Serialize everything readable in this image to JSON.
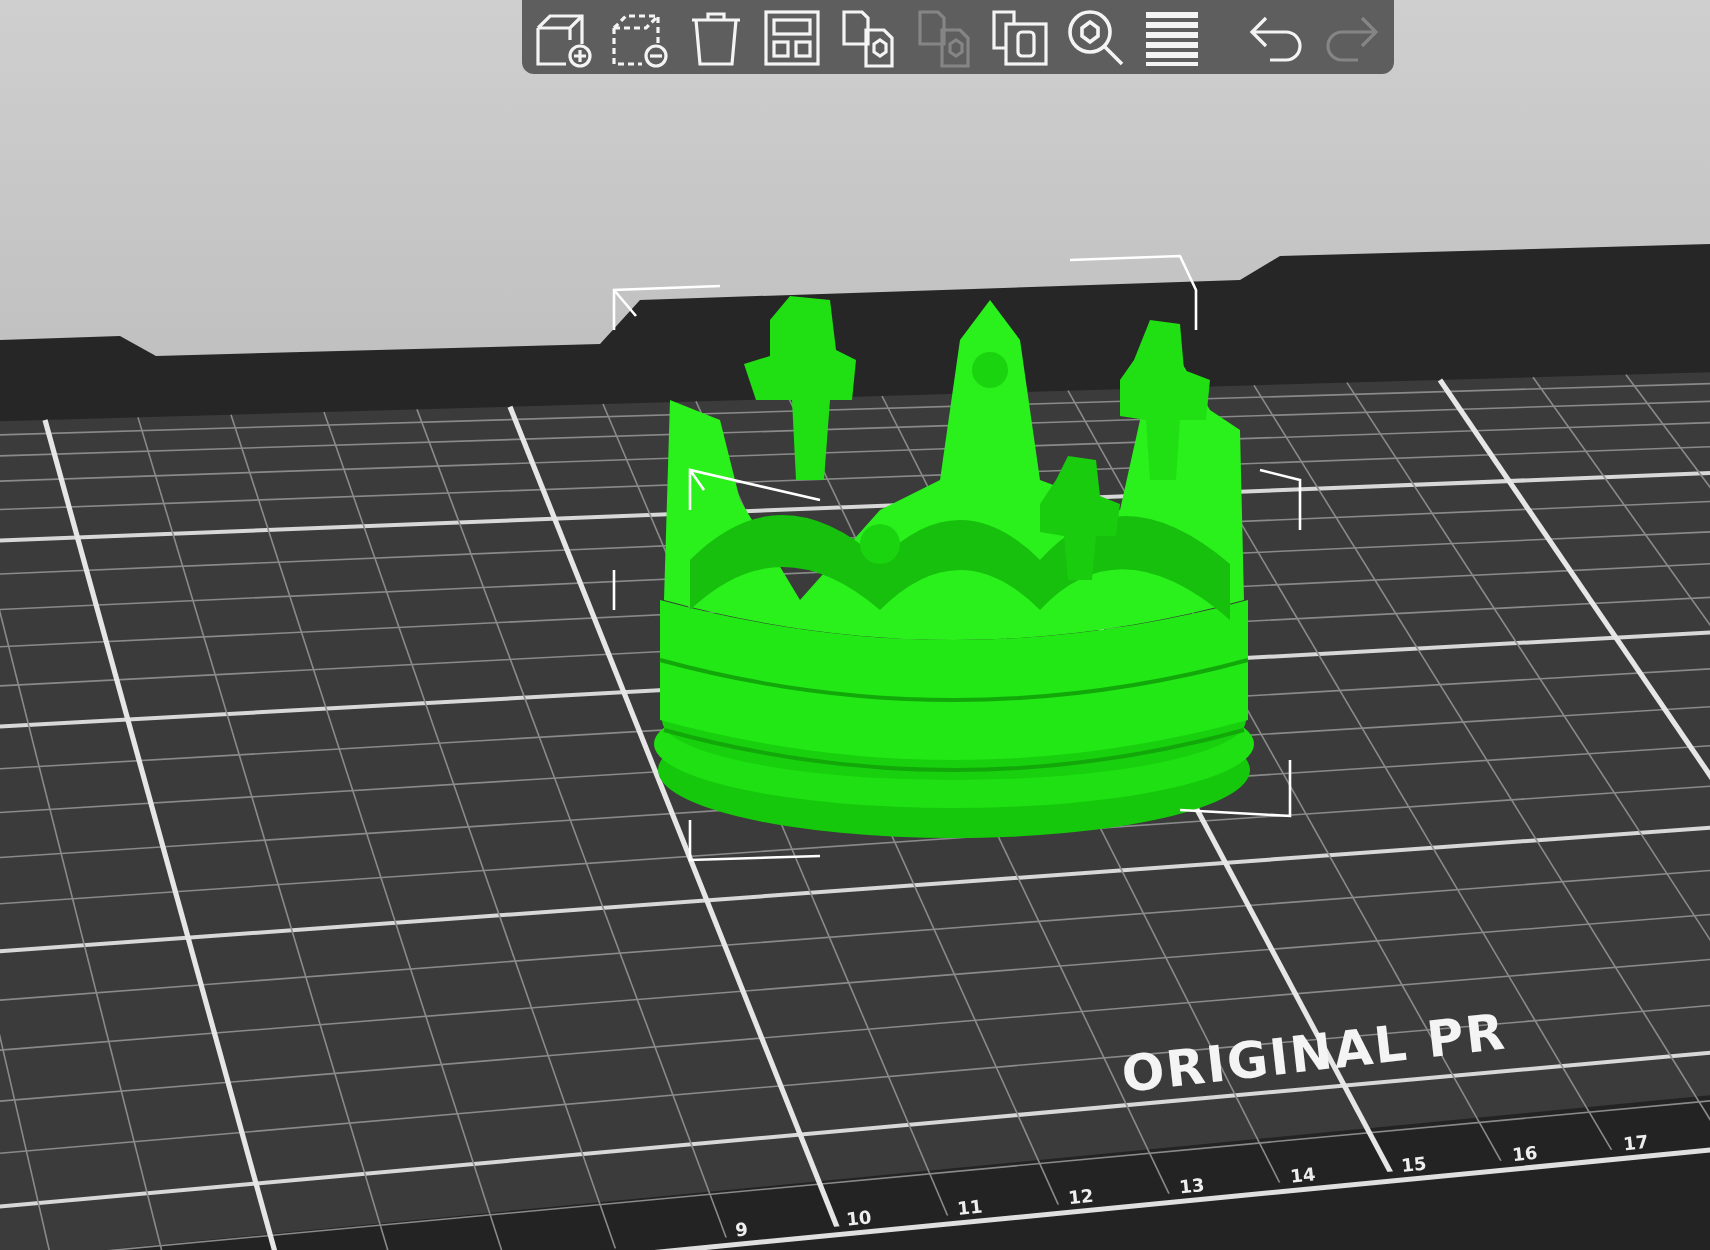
{
  "toolbar": {
    "buttons": [
      {
        "kind": "add",
        "disabled": false
      },
      {
        "kind": "delete",
        "disabled": false
      },
      {
        "kind": "delete_all",
        "disabled": false
      },
      {
        "kind": "arrange",
        "disabled": false
      },
      {
        "kind": "copy",
        "disabled": false
      },
      {
        "kind": "paste",
        "disabled": true
      },
      {
        "kind": "instances",
        "disabled": false
      },
      {
        "kind": "search",
        "disabled": false
      },
      {
        "kind": "layers",
        "disabled": false
      },
      {
        "kind": "undo",
        "disabled": false
      },
      {
        "kind": "redo",
        "disabled": true
      }
    ]
  },
  "bed": {
    "label": "ORIGINAL PR",
    "ruler": [
      "9",
      "10",
      "11",
      "12",
      "13",
      "14",
      "15",
      "16",
      "17"
    ]
  }
}
